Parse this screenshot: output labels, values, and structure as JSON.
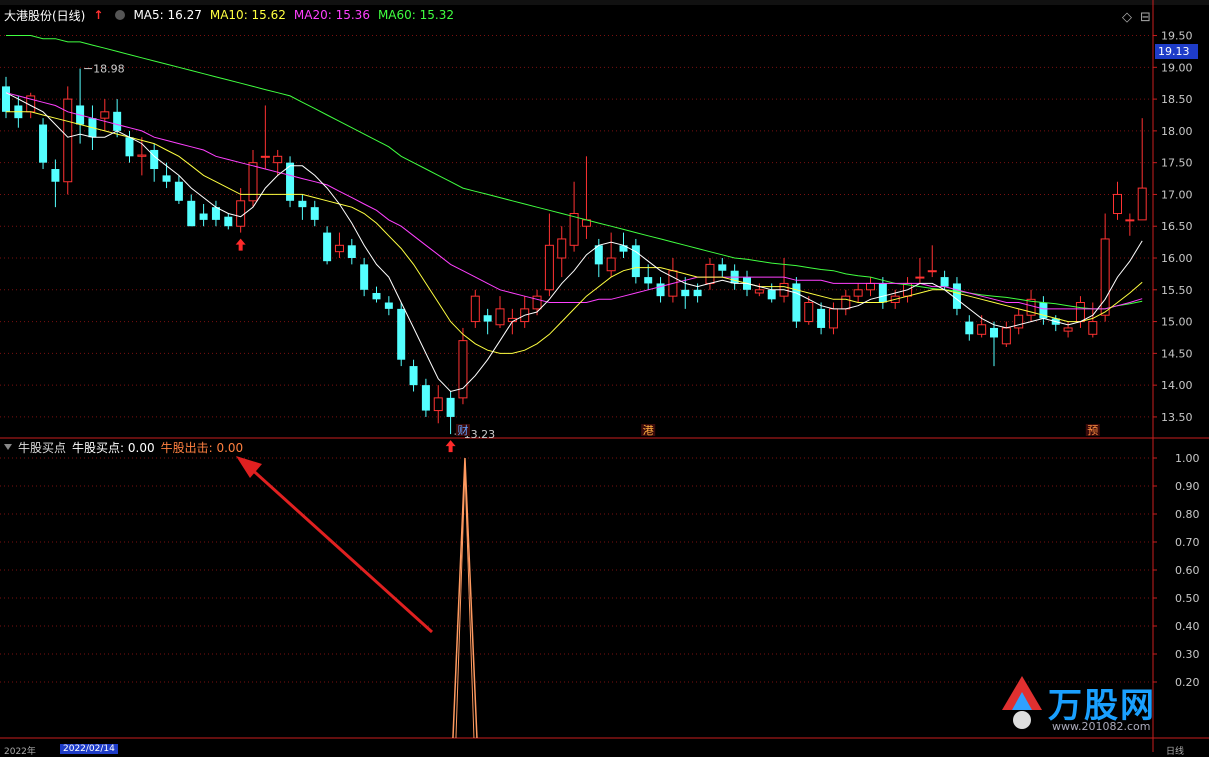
{
  "header": {
    "stock_name": "大港股份(日线)",
    "ma_items": [
      {
        "label": "MA5: 16.27",
        "color": "#ffffff"
      },
      {
        "label": "MA10: 15.62",
        "color": "#ffff40"
      },
      {
        "label": "MA20: 15.36",
        "color": "#ff40ff"
      },
      {
        "label": "MA60: 15.32",
        "color": "#40ff40"
      }
    ]
  },
  "subpanel": {
    "indicator_name": "牛股买点",
    "buy_label": "牛股买点: 0.00",
    "exit_label": "牛股出击: 0.00"
  },
  "price_tag": "19.13",
  "window_controls": [
    "◇",
    "⊟"
  ],
  "axis_bottom": {
    "left_date": "2022年",
    "selected_date": "2022/02/14",
    "mode": "日线"
  },
  "logo": {
    "text": "万股网",
    "url": "www.201082.com"
  },
  "colors": {
    "up": "#ff3232",
    "down": "#54ffff",
    "ma5": "#ffffff",
    "ma10": "#ffff40",
    "ma20": "#ff40ff",
    "ma60": "#40ff40",
    "grid": "#7a1010",
    "axis": "#c81e1e"
  },
  "chart_data": [
    {
      "type": "candlestick",
      "title": "大港股份(日线)",
      "ylim": [
        13.2,
        19.65
      ],
      "yticks": [
        13.5,
        14.0,
        14.5,
        15.0,
        15.5,
        16.0,
        16.5,
        17.0,
        17.5,
        18.0,
        18.5,
        19.0,
        19.5
      ],
      "annotations": [
        {
          "label": "18.98",
          "index": 6
        },
        {
          "label": "13.23",
          "index": 36
        }
      ],
      "event_markers": [
        {
          "label": "财",
          "index": 37
        },
        {
          "label": "港",
          "index": 52
        },
        {
          "label": "预",
          "index": 88
        }
      ],
      "buy_arrows": [
        19,
        36
      ],
      "candles": [
        [
          18.7,
          18.3,
          18.85,
          18.2
        ],
        [
          18.4,
          18.2,
          18.55,
          18.05
        ],
        [
          18.3,
          18.55,
          18.6,
          18.2
        ],
        [
          18.1,
          17.5,
          18.2,
          17.4
        ],
        [
          17.4,
          17.2,
          17.55,
          16.8
        ],
        [
          17.2,
          18.5,
          18.7,
          17.0
        ],
        [
          18.4,
          18.1,
          18.98,
          17.8
        ],
        [
          18.2,
          17.9,
          18.4,
          17.7
        ],
        [
          18.2,
          18.3,
          18.5,
          18.0
        ],
        [
          18.3,
          18.0,
          18.5,
          17.9
        ],
        [
          17.9,
          17.6,
          18.0,
          17.5
        ],
        [
          17.6,
          17.62,
          17.9,
          17.3
        ],
        [
          17.7,
          17.4,
          17.8,
          17.2
        ],
        [
          17.3,
          17.2,
          17.5,
          17.1
        ],
        [
          17.2,
          16.9,
          17.3,
          16.85
        ],
        [
          16.9,
          16.5,
          17.0,
          16.5
        ],
        [
          16.7,
          16.6,
          16.85,
          16.5
        ],
        [
          16.8,
          16.6,
          16.9,
          16.5
        ],
        [
          16.65,
          16.5,
          16.7,
          16.45
        ],
        [
          16.5,
          16.9,
          17.1,
          16.4
        ],
        [
          16.9,
          17.5,
          17.7,
          16.8
        ],
        [
          17.6,
          17.6,
          18.4,
          17.4
        ],
        [
          17.5,
          17.6,
          17.7,
          17.3
        ],
        [
          17.5,
          16.9,
          17.6,
          16.8
        ],
        [
          16.9,
          16.8,
          17.0,
          16.6
        ],
        [
          16.8,
          16.6,
          16.9,
          16.5
        ],
        [
          16.4,
          15.95,
          16.5,
          15.9
        ],
        [
          16.1,
          16.2,
          16.4,
          16.0
        ],
        [
          16.2,
          16.0,
          16.3,
          15.9
        ],
        [
          15.9,
          15.5,
          16.0,
          15.4
        ],
        [
          15.45,
          15.35,
          15.55,
          15.3
        ],
        [
          15.3,
          15.2,
          15.4,
          15.1
        ],
        [
          15.2,
          14.4,
          15.3,
          14.3
        ],
        [
          14.3,
          14.0,
          14.4,
          13.9
        ],
        [
          14.0,
          13.6,
          14.1,
          13.5
        ],
        [
          13.6,
          13.8,
          14.0,
          13.4
        ],
        [
          13.8,
          13.5,
          13.9,
          13.23
        ],
        [
          13.8,
          14.7,
          14.9,
          13.7
        ],
        [
          15.0,
          15.4,
          15.5,
          14.9
        ],
        [
          15.1,
          15.0,
          15.2,
          14.8
        ],
        [
          14.95,
          15.2,
          15.4,
          14.9
        ],
        [
          15.0,
          15.05,
          15.2,
          14.8
        ],
        [
          15.0,
          15.2,
          15.4,
          14.9
        ],
        [
          15.2,
          15.4,
          15.5,
          15.1
        ],
        [
          15.5,
          16.2,
          16.7,
          15.4
        ],
        [
          16.0,
          16.3,
          16.5,
          15.7
        ],
        [
          16.2,
          16.7,
          17.2,
          16.1
        ],
        [
          16.5,
          16.6,
          17.6,
          16.3
        ],
        [
          16.2,
          15.9,
          16.3,
          15.7
        ],
        [
          15.8,
          16.0,
          16.4,
          15.7
        ],
        [
          16.2,
          16.1,
          16.4,
          16.0
        ],
        [
          16.2,
          15.7,
          16.3,
          15.6
        ],
        [
          15.7,
          15.6,
          15.9,
          15.5
        ],
        [
          15.6,
          15.4,
          15.7,
          15.3
        ],
        [
          15.4,
          15.8,
          16.0,
          15.3
        ],
        [
          15.5,
          15.4,
          15.7,
          15.2
        ],
        [
          15.5,
          15.4,
          15.6,
          15.3
        ],
        [
          15.6,
          15.9,
          16.0,
          15.5
        ],
        [
          15.9,
          15.8,
          16.0,
          15.7
        ],
        [
          15.8,
          15.6,
          15.9,
          15.5
        ],
        [
          15.7,
          15.5,
          15.8,
          15.4
        ],
        [
          15.45,
          15.5,
          15.6,
          15.4
        ],
        [
          15.5,
          15.35,
          15.6,
          15.3
        ],
        [
          15.4,
          15.6,
          16.0,
          15.3
        ],
        [
          15.6,
          15.0,
          15.7,
          14.9
        ],
        [
          15.0,
          15.3,
          15.4,
          14.95
        ],
        [
          15.2,
          14.9,
          15.3,
          14.8
        ],
        [
          14.9,
          15.2,
          15.3,
          14.8
        ],
        [
          15.2,
          15.4,
          15.5,
          15.1
        ],
        [
          15.4,
          15.5,
          15.6,
          15.3
        ],
        [
          15.5,
          15.6,
          15.7,
          15.4
        ],
        [
          15.6,
          15.3,
          15.7,
          15.2
        ],
        [
          15.3,
          15.4,
          15.5,
          15.2
        ],
        [
          15.4,
          15.6,
          15.7,
          15.3
        ],
        [
          15.7,
          15.7,
          16.0,
          15.6
        ],
        [
          15.8,
          15.8,
          16.2,
          15.7
        ],
        [
          15.7,
          15.55,
          15.8,
          15.5
        ],
        [
          15.6,
          15.2,
          15.7,
          15.1
        ],
        [
          15.0,
          14.8,
          15.1,
          14.7
        ],
        [
          14.8,
          14.95,
          15.1,
          14.75
        ],
        [
          14.9,
          14.75,
          15.0,
          14.3
        ],
        [
          14.65,
          14.9,
          15.0,
          14.6
        ],
        [
          14.9,
          15.1,
          15.2,
          14.8
        ],
        [
          15.1,
          15.35,
          15.5,
          15.0
        ],
        [
          15.3,
          15.05,
          15.4,
          14.95
        ],
        [
          15.05,
          14.95,
          15.1,
          14.85
        ],
        [
          14.85,
          14.9,
          15.0,
          14.75
        ],
        [
          15.0,
          15.3,
          15.4,
          14.9
        ],
        [
          14.8,
          15.0,
          15.3,
          14.75
        ],
        [
          15.1,
          16.3,
          16.7,
          15.0
        ],
        [
          16.7,
          17.0,
          17.2,
          16.6
        ],
        [
          16.6,
          16.6,
          16.7,
          16.35
        ],
        [
          16.6,
          17.1,
          18.2,
          16.6
        ]
      ],
      "ma5": [
        18.6,
        18.5,
        18.4,
        18.3,
        18.1,
        17.9,
        17.95,
        17.9,
        17.9,
        18.0,
        17.9,
        17.8,
        17.6,
        17.45,
        17.3,
        17.1,
        16.95,
        16.8,
        16.7,
        16.65,
        16.8,
        17.1,
        17.3,
        17.45,
        17.45,
        17.3,
        17.1,
        16.85,
        16.55,
        16.2,
        15.9,
        15.7,
        15.3,
        14.9,
        14.5,
        14.1,
        13.9,
        13.95,
        14.15,
        14.4,
        14.7,
        15.0,
        15.1,
        15.15,
        15.35,
        15.6,
        15.8,
        16.05,
        16.2,
        16.25,
        16.2,
        16.1,
        15.95,
        15.8,
        15.7,
        15.6,
        15.55,
        15.6,
        15.65,
        15.6,
        15.6,
        15.55,
        15.5,
        15.5,
        15.45,
        15.35,
        15.25,
        15.2,
        15.2,
        15.25,
        15.35,
        15.4,
        15.45,
        15.5,
        15.6,
        15.6,
        15.5,
        15.35,
        15.2,
        15.05,
        14.95,
        14.9,
        14.95,
        15.0,
        15.05,
        15.0,
        14.95,
        15.0,
        15.1,
        15.35,
        15.7,
        15.95,
        16.27
      ],
      "ma10": [
        18.3,
        18.3,
        18.3,
        18.25,
        18.2,
        18.15,
        18.1,
        18.05,
        18.0,
        17.95,
        17.9,
        17.85,
        17.8,
        17.7,
        17.6,
        17.45,
        17.3,
        17.2,
        17.1,
        17.0,
        17.0,
        17.0,
        17.0,
        17.0,
        17.0,
        16.95,
        16.9,
        16.85,
        16.8,
        16.7,
        16.55,
        16.35,
        16.15,
        15.9,
        15.6,
        15.3,
        15.0,
        14.8,
        14.65,
        14.55,
        14.5,
        14.5,
        14.55,
        14.65,
        14.8,
        15.0,
        15.2,
        15.4,
        15.55,
        15.7,
        15.8,
        15.85,
        15.85,
        15.85,
        15.8,
        15.75,
        15.7,
        15.7,
        15.7,
        15.65,
        15.6,
        15.55,
        15.55,
        15.55,
        15.5,
        15.45,
        15.4,
        15.35,
        15.35,
        15.3,
        15.3,
        15.3,
        15.35,
        15.4,
        15.45,
        15.5,
        15.5,
        15.45,
        15.4,
        15.35,
        15.3,
        15.25,
        15.2,
        15.15,
        15.1,
        15.05,
        15.0,
        15.0,
        15.05,
        15.15,
        15.3,
        15.45,
        15.62
      ],
      "ma20": [
        18.6,
        18.55,
        18.5,
        18.45,
        18.4,
        18.3,
        18.25,
        18.2,
        18.15,
        18.1,
        18.05,
        18.0,
        17.9,
        17.85,
        17.8,
        17.75,
        17.7,
        17.6,
        17.55,
        17.5,
        17.45,
        17.4,
        17.35,
        17.3,
        17.25,
        17.2,
        17.15,
        17.05,
        16.95,
        16.85,
        16.75,
        16.6,
        16.5,
        16.35,
        16.2,
        16.05,
        15.9,
        15.8,
        15.7,
        15.6,
        15.5,
        15.45,
        15.4,
        15.35,
        15.3,
        15.3,
        15.3,
        15.3,
        15.35,
        15.35,
        15.4,
        15.45,
        15.5,
        15.55,
        15.6,
        15.65,
        15.7,
        15.7,
        15.7,
        15.7,
        15.7,
        15.7,
        15.7,
        15.7,
        15.65,
        15.65,
        15.65,
        15.6,
        15.6,
        15.6,
        15.6,
        15.6,
        15.6,
        15.6,
        15.6,
        15.55,
        15.55,
        15.5,
        15.45,
        15.4,
        15.35,
        15.3,
        15.3,
        15.25,
        15.2,
        15.2,
        15.2,
        15.2,
        15.2,
        15.2,
        15.25,
        15.3,
        15.36
      ],
      "ma60": [
        19.5,
        19.5,
        19.5,
        19.45,
        19.45,
        19.4,
        19.4,
        19.35,
        19.3,
        19.25,
        19.2,
        19.15,
        19.1,
        19.05,
        19.0,
        18.95,
        18.9,
        18.85,
        18.8,
        18.75,
        18.7,
        18.65,
        18.6,
        18.55,
        18.45,
        18.35,
        18.25,
        18.15,
        18.05,
        17.95,
        17.85,
        17.75,
        17.6,
        17.5,
        17.4,
        17.3,
        17.2,
        17.1,
        17.05,
        17.0,
        16.95,
        16.9,
        16.85,
        16.8,
        16.75,
        16.7,
        16.65,
        16.6,
        16.55,
        16.5,
        16.45,
        16.4,
        16.35,
        16.3,
        16.25,
        16.2,
        16.15,
        16.1,
        16.05,
        16.0,
        15.98,
        15.95,
        15.92,
        15.9,
        15.88,
        15.85,
        15.82,
        15.8,
        15.75,
        15.72,
        15.7,
        15.65,
        15.6,
        15.58,
        15.55,
        15.52,
        15.5,
        15.48,
        15.45,
        15.42,
        15.4,
        15.38,
        15.35,
        15.32,
        15.3,
        15.28,
        15.25,
        15.22,
        15.2,
        15.2,
        15.25,
        15.28,
        15.32
      ]
    },
    {
      "type": "line",
      "title": "牛股买点",
      "ylim": [
        0.0,
        1.05
      ],
      "yticks": [
        0.2,
        0.3,
        0.4,
        0.5,
        0.6,
        0.7,
        0.8,
        0.9,
        1.0
      ],
      "spike_index": 37,
      "spike_value": 1.0
    }
  ]
}
